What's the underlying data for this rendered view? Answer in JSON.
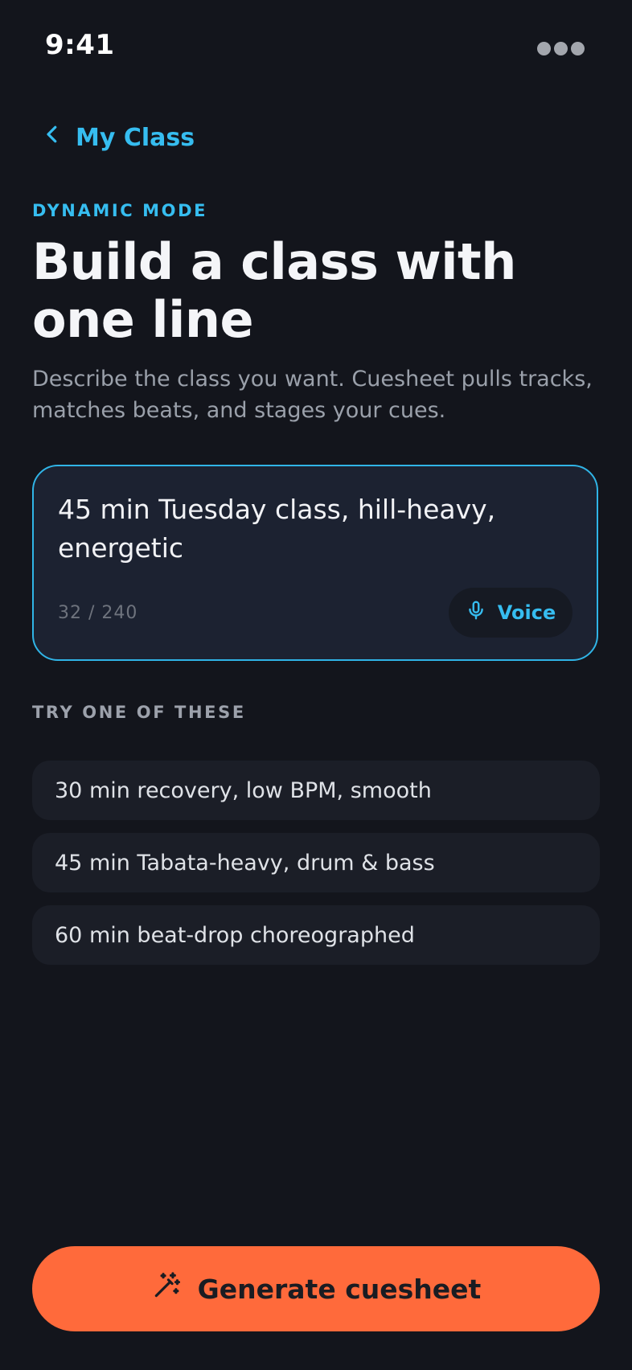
{
  "status_bar": {
    "time": "9:41",
    "menu_icon": "more-dots-icon"
  },
  "nav": {
    "back_label": "My Class",
    "back_icon": "chevron-left-icon"
  },
  "header": {
    "eyebrow": "DYNAMIC MODE",
    "title": "Build a class with one line",
    "subtitle": "Describe the class you want. Cuesheet pulls tracks, matches beats, and stages your cues."
  },
  "prompt": {
    "value": "45 min Tuesday class, hill-heavy, energetic",
    "char_count": "32 / 240",
    "voice_label": "Voice",
    "voice_icon": "microphone-icon"
  },
  "suggestions": {
    "label": "TRY ONE OF THESE",
    "items": [
      {
        "text": "30 min recovery, low BPM, smooth"
      },
      {
        "text": "45 min Tabata-heavy, drum & bass"
      },
      {
        "text": "60 min beat-drop choreographed"
      }
    ]
  },
  "cta": {
    "label": "Generate cuesheet",
    "icon": "magic-wand-icon"
  },
  "colors": {
    "background": "#13151c",
    "accent": "#36bdf0",
    "cta": "#ff6a3b",
    "card": "#1c2231"
  }
}
